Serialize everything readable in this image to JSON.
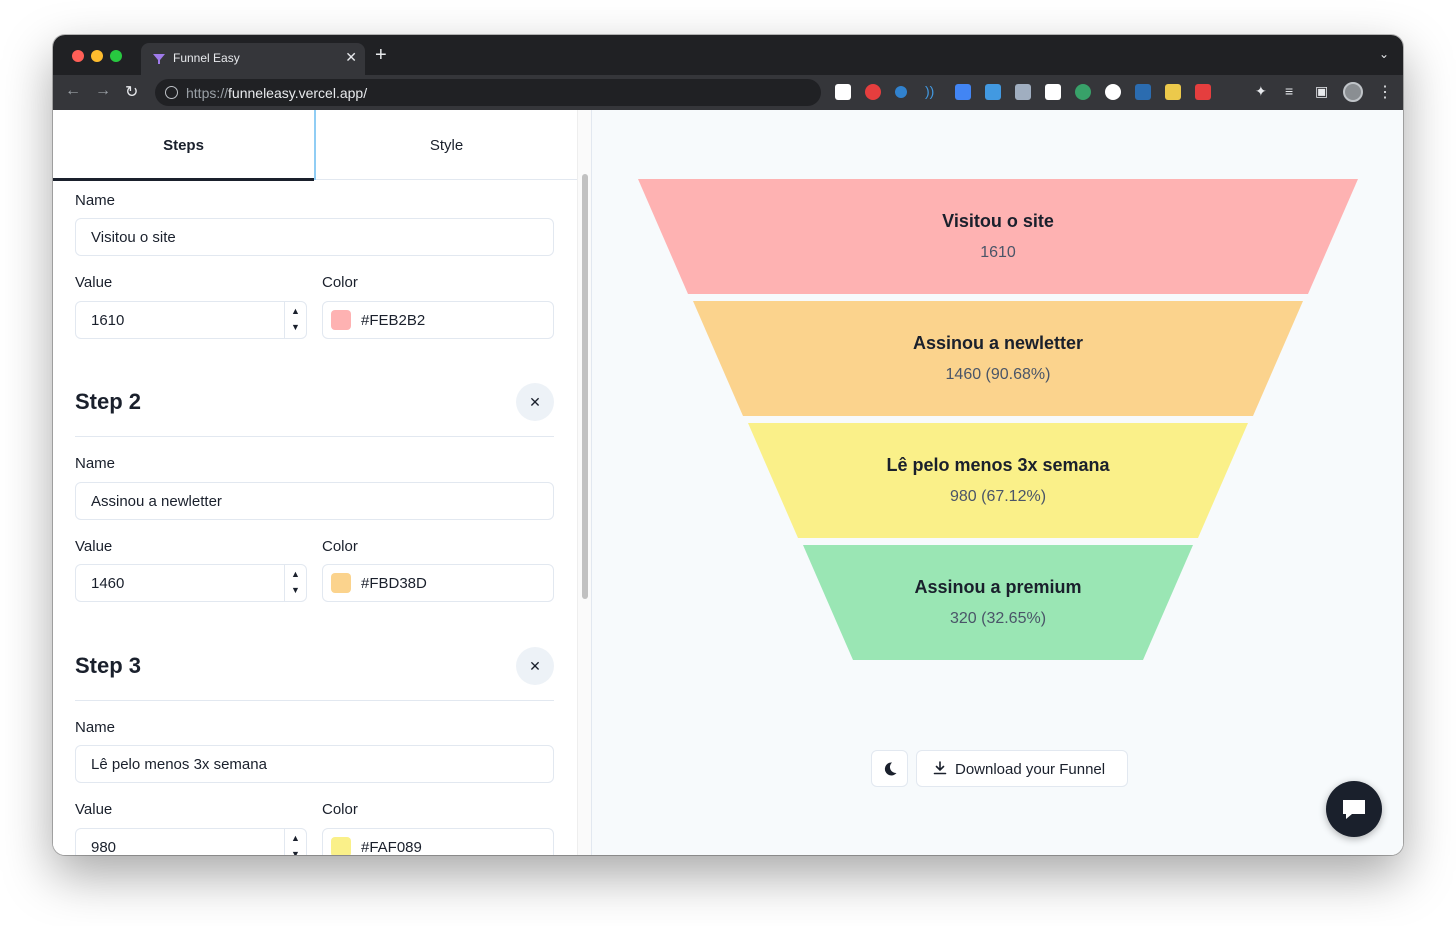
{
  "browser": {
    "tab_title": "Funnel Easy",
    "url_prefix": "https://",
    "url_host": "funneleasy.vercel.app/"
  },
  "editor": {
    "tabs": [
      "Steps",
      "Style"
    ],
    "labels": {
      "name": "Name",
      "value": "Value",
      "color": "Color"
    },
    "steps": [
      {
        "heading": "",
        "name": "Visitou o site",
        "value": "1610",
        "color": "#FEB2B2"
      },
      {
        "heading": "Step 2",
        "name": "Assinou a newletter",
        "value": "1460",
        "color": "#FBD38D"
      },
      {
        "heading": "Step 3",
        "name": "Lê pelo menos 3x semana",
        "value": "980",
        "color": "#FAF089"
      }
    ]
  },
  "funnel": {
    "segments": [
      {
        "label": "Visitou o site",
        "value": "1610",
        "color": "#FEB2B2"
      },
      {
        "label": "Assinou a newletter",
        "value": "1460 (90.68%)",
        "color": "#FBD38D"
      },
      {
        "label": "Lê pelo menos 3x semana",
        "value": "980 (67.12%)",
        "color": "#FAF089"
      },
      {
        "label": "Assinou a premium",
        "value": "320 (32.65%)",
        "color": "#9AE6B4"
      }
    ]
  },
  "actions": {
    "download_label": "Download your Funnel",
    "dark_mode_icon": "moon-icon",
    "chat_icon": "chat-icon"
  }
}
